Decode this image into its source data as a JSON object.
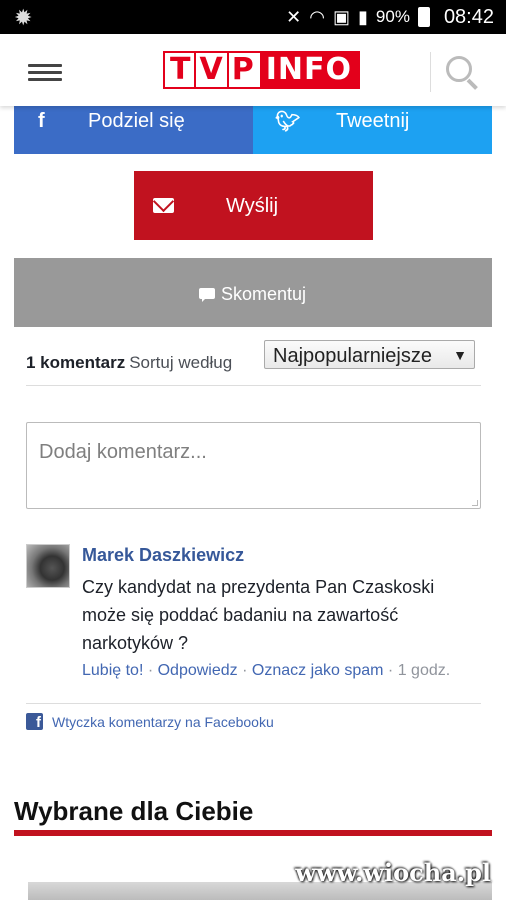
{
  "status_bar": {
    "battery": "90%",
    "time": "08:42"
  },
  "header": {
    "logo_left": [
      "T",
      "V",
      "P"
    ],
    "logo_right": "INFO"
  },
  "share": {
    "facebook_label": "Podziel się",
    "twitter_label": "Tweetnij",
    "send_label": "Wyślij",
    "comment_label": "Skomentuj"
  },
  "comments": {
    "count_label": "1 komentarz",
    "sort_label": "Sortuj według",
    "sort_selected": "Najpopularniejsze",
    "input_placeholder": "Dodaj komentarz...",
    "items": [
      {
        "author": "Marek Daszkiewicz",
        "text": "Czy kandydat na prezydenta Pan Czaskoski może się poddać badaniu na zawartość narkotyków ?",
        "like": "Lubię to!",
        "reply": "Odpowiedz",
        "spam": "Oznacz jako spam",
        "time": "1 godz."
      }
    ],
    "plugin_label": "Wtyczka komentarzy na Facebooku"
  },
  "section": {
    "title": "Wybrane dla Ciebie"
  },
  "watermark": "www.wiocha.pl",
  "colors": {
    "brand_red": "#e3001b",
    "facebook": "#3b6cc6",
    "twitter": "#1da1f2",
    "send": "#c1121f",
    "comment": "#999999",
    "link": "#365899"
  }
}
